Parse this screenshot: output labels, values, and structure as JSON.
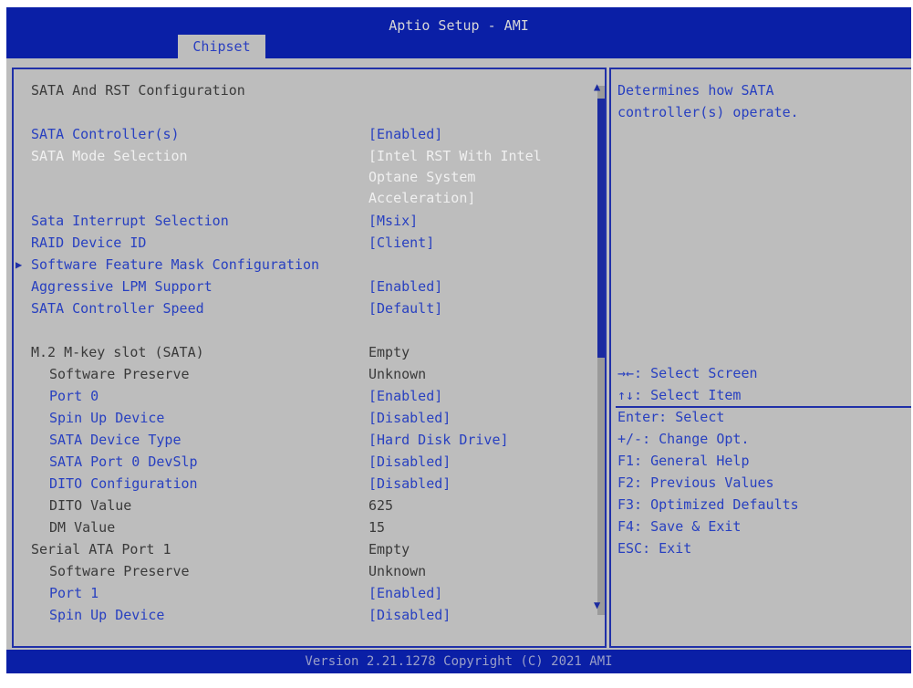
{
  "window": {
    "title": "Aptio Setup - AMI",
    "tab": "Chipset"
  },
  "main": {
    "section_title": "SATA And RST Configuration",
    "rows": [
      {
        "label": "SATA Controller(s)",
        "value": "[Enabled]"
      },
      {
        "label": "SATA Mode Selection",
        "value_lines": [
          "[Intel RST With Intel",
          "Optane System",
          "Acceleration]"
        ]
      },
      {
        "label": "Sata Interrupt Selection",
        "value": "[Msix]"
      },
      {
        "label": "RAID Device ID",
        "value": "[Client]"
      },
      {
        "label": "Software Feature Mask Configuration",
        "value": ""
      },
      {
        "label": "Aggressive LPM Support",
        "value": "[Enabled]"
      },
      {
        "label": "SATA Controller Speed",
        "value": "[Default]"
      },
      {
        "label": "M.2 M-key slot (SATA)",
        "value": "Empty"
      },
      {
        "label": "Software Preserve",
        "value": "Unknown"
      },
      {
        "label": "Port 0",
        "value": "[Enabled]"
      },
      {
        "label": "Spin Up Device",
        "value": "[Disabled]"
      },
      {
        "label": "SATA Device Type",
        "value": "[Hard Disk Drive]"
      },
      {
        "label": "SATA Port 0 DevSlp",
        "value": "[Disabled]"
      },
      {
        "label": "DITO Configuration",
        "value": "[Disabled]"
      },
      {
        "label": "DITO Value",
        "value": "625"
      },
      {
        "label": "DM Value",
        "value": "15"
      },
      {
        "label": "Serial ATA Port 1",
        "value": "Empty"
      },
      {
        "label": "Software Preserve",
        "value": "Unknown"
      },
      {
        "label": "Port 1",
        "value": "[Enabled]"
      },
      {
        "label": "Spin Up Device",
        "value": "[Disabled]"
      }
    ]
  },
  "help": {
    "description": [
      "Determines how SATA",
      "controller(s) operate."
    ],
    "keys": [
      "→←: Select Screen",
      "↑↓: Select Item",
      "Enter: Select",
      "+/-: Change Opt.",
      "F1: General Help",
      "F2: Previous Values",
      "F3: Optimized Defaults",
      "F4: Save & Exit",
      "ESC: Exit"
    ]
  },
  "footer": {
    "text": "Version 2.21.1278 Copyright (C) 2021 AMI"
  },
  "colors": {
    "header_bg": "#0a1fa6",
    "screen_bg": "#bdbdbd",
    "option_blue": "#2840c0",
    "selected_white": "#f0f0f0",
    "static_text": "#3a3a3a"
  }
}
